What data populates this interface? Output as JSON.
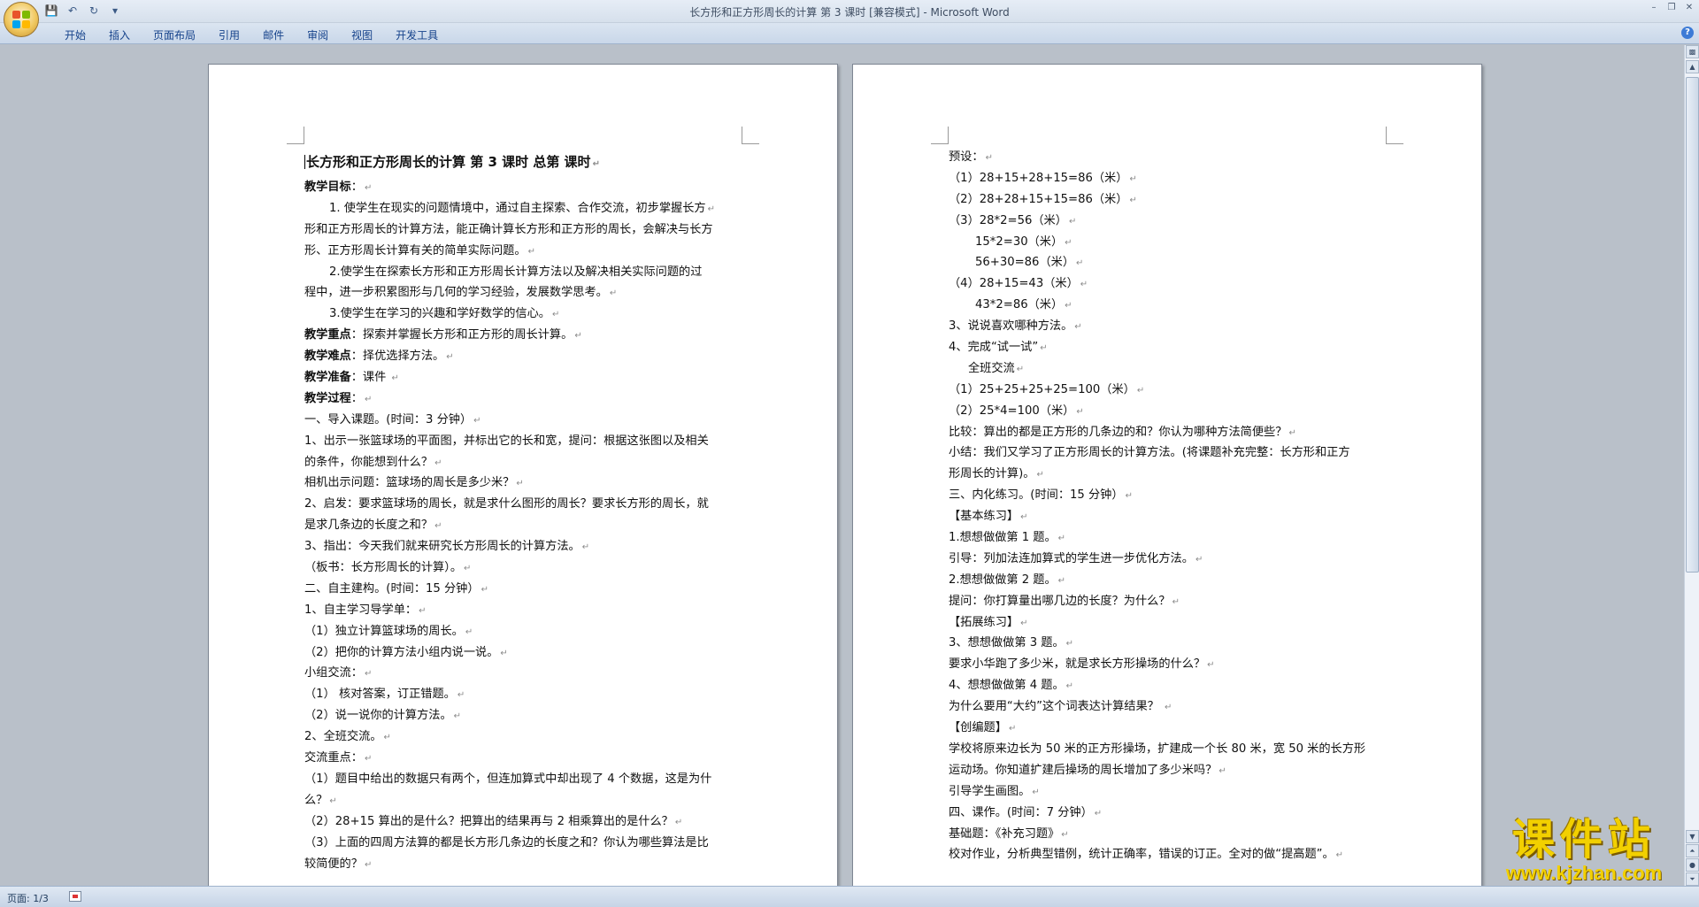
{
  "window": {
    "title": "长方形和正方形周长的计算    第 3 课时 [兼容模式] - Microsoft Word"
  },
  "ribbon": {
    "tabs": [
      "开始",
      "插入",
      "页面布局",
      "引用",
      "邮件",
      "审阅",
      "视图",
      "开发工具"
    ]
  },
  "page1": {
    "heading": "长方形和正方形周长的计算       第  3  课时      总第       课时",
    "lines": [
      {
        "b": "教学目标",
        "t": "：",
        "ind": 0
      },
      {
        "t": "1.  使学生在现实的问题情境中，通过自主探索、合作交流，初步掌握长方",
        "ind": 1
      },
      {
        "t": "形和正方形周长的计算方法，能正确计算长方形和正方形的周长，会解决与长方",
        "ind": 0,
        "nopm": true
      },
      {
        "t": "形、正方形周长计算有关的简单实际问题。",
        "ind": 0
      },
      {
        "t": "2.使学生在探索长方形和正方形周长计算方法以及解决相关实际问题的过",
        "ind": 1,
        "nopm": true
      },
      {
        "t": "程中，进一步积累图形与几何的学习经验，发展数学思考。",
        "ind": 0
      },
      {
        "t": "3.使学生在学习的兴趣和学好数学的信心。",
        "ind": 1
      },
      {
        "b": "教学重点",
        "t": "：探索并掌握长方形和正方形的周长计算。",
        "ind": 0
      },
      {
        "b": "教学难点",
        "t": "：择优选择方法。",
        "ind": 0
      },
      {
        "b": "教学准备",
        "t": "：课件    ",
        "ind": 0
      },
      {
        "b": "教学过程",
        "t": "：",
        "ind": 0
      },
      {
        "t": "一、导入课题。(时间：3 分钟）",
        "ind": 0
      },
      {
        "t": "1、出示一张篮球场的平面图，并标出它的长和宽，提问：根据这张图以及相关",
        "ind": 0,
        "nopm": true
      },
      {
        "t": "的条件，你能想到什么？",
        "ind": 0
      },
      {
        "t": "相机出示问题：篮球场的周长是多少米？",
        "ind": 0
      },
      {
        "t": "2、启发：要求篮球场的周长，就是求什么图形的周长？要求长方形的周长，就",
        "ind": 0,
        "nopm": true
      },
      {
        "t": "是求几条边的长度之和？",
        "ind": 0
      },
      {
        "t": "3、指出：今天我们就来研究长方形周长的计算方法。",
        "ind": 0
      },
      {
        "t": "（板书：长方形周长的计算）。",
        "ind": 0
      },
      {
        "t": "二、自主建构。(时间：15 分钟）",
        "ind": 0
      },
      {
        "t": "1、自主学习导学单：",
        "ind": 0
      },
      {
        "t": "（1）独立计算篮球场的周长。",
        "ind": 0
      },
      {
        "t": "（2）把你的计算方法小组内说一说。",
        "ind": 0
      },
      {
        "t": "小组交流：",
        "ind": 0
      },
      {
        "t": "（1）  核对答案，订正错题。",
        "ind": 0
      },
      {
        "t": "（2）说一说你的计算方法。",
        "ind": 0
      },
      {
        "t": "2、全班交流。",
        "ind": 0
      },
      {
        "t": "交流重点：",
        "ind": 0
      },
      {
        "t": "（1）题目中给出的数据只有两个，但连加算式中却出现了 4 个数据，这是为什",
        "ind": 0,
        "nopm": true
      },
      {
        "t": "么？",
        "ind": 0
      },
      {
        "t": "（2）28+15 算出的是什么？把算出的结果再与 2 相乘算出的是什么？",
        "ind": 0
      },
      {
        "t": "（3）上面的四周方法算的都是长方形几条边的长度之和？你认为哪些算法是比",
        "ind": 0,
        "nopm": true
      },
      {
        "t": "较简便的？",
        "ind": 0
      }
    ]
  },
  "page2": {
    "lines": [
      {
        "t": "预设：",
        "ind": 0
      },
      {
        "t": "（1）28+15+28+15=86（米）",
        "ind": 0
      },
      {
        "t": "（2）28+28+15+15=86（米）",
        "ind": 0
      },
      {
        "t": "（3）28*2=56（米）",
        "ind": 0
      },
      {
        "t": "15*2=30（米）",
        "ind": 2
      },
      {
        "t": "56+30=86（米）",
        "ind": 2
      },
      {
        "t": "（4）28+15=43（米）",
        "ind": 0
      },
      {
        "t": "43*2=86（米）",
        "ind": 2
      },
      {
        "t": "3、说说喜欢哪种方法。",
        "ind": 0
      },
      {
        "t": "4、完成“试一试”",
        "ind": 0
      },
      {
        "t": "全班交流",
        "ind": 3
      },
      {
        "t": "（1）25+25+25+25=100（米）",
        "ind": 0
      },
      {
        "t": "（2）25*4=100（米）",
        "ind": 0
      },
      {
        "t": "比较：算出的都是正方形的几条边的和？你认为哪种方法简便些？",
        "ind": 0
      },
      {
        "t": "小结：我们又学习了正方形周长的计算方法。(将课题补充完整：长方形和正方",
        "ind": 0,
        "nopm": true
      },
      {
        "t": "形周长的计算)。",
        "ind": 0
      },
      {
        "t": "三、内化练习。(时间：15 分钟）",
        "ind": 0
      },
      {
        "t": "【基本练习】",
        "ind": 0
      },
      {
        "t": "1.想想做做第 1 题。",
        "ind": 0
      },
      {
        "t": "引导：列加法连加算式的学生进一步优化方法。",
        "ind": 0
      },
      {
        "t": "2.想想做做第 2 题。",
        "ind": 0
      },
      {
        "t": "提问：你打算量出哪几边的长度？为什么？",
        "ind": 0
      },
      {
        "t": "【拓展练习】",
        "ind": 0
      },
      {
        "t": "3、想想做做第 3 题。",
        "ind": 0
      },
      {
        "t": "要求小华跑了多少米，就是求长方形操场的什么？",
        "ind": 0
      },
      {
        "t": "4、想想做做第 4 题。",
        "ind": 0
      },
      {
        "t": "为什么要用“大约”这个词表达计算结果？  ",
        "ind": 0
      },
      {
        "t": "【创编题】",
        "ind": 0
      },
      {
        "t": "学校将原来边长为 50 米的正方形操场，扩建成一个长 80 米，宽 50 米的长方形",
        "ind": 0,
        "nopm": true
      },
      {
        "t": "运动场。你知道扩建后操场的周长增加了多少米吗？",
        "ind": 0
      },
      {
        "t": "引导学生画图。",
        "ind": 0
      },
      {
        "t": "四、课作。(时间：7 分钟）",
        "ind": 0
      },
      {
        "t": "基础题：《补充习题》",
        "ind": 0
      },
      {
        "t": "校对作业，分析典型错例，统计正确率，错误的订正。全对的做“提高题”。",
        "ind": 0
      }
    ]
  },
  "statusbar": {
    "page_info": "页面: 1/3"
  },
  "watermark": {
    "title": "课件站",
    "url": "www.kjzhan.com"
  },
  "colors": {
    "accent": "#15428b",
    "workspace": "#b9c0c9",
    "watermark": "#f2d000"
  }
}
